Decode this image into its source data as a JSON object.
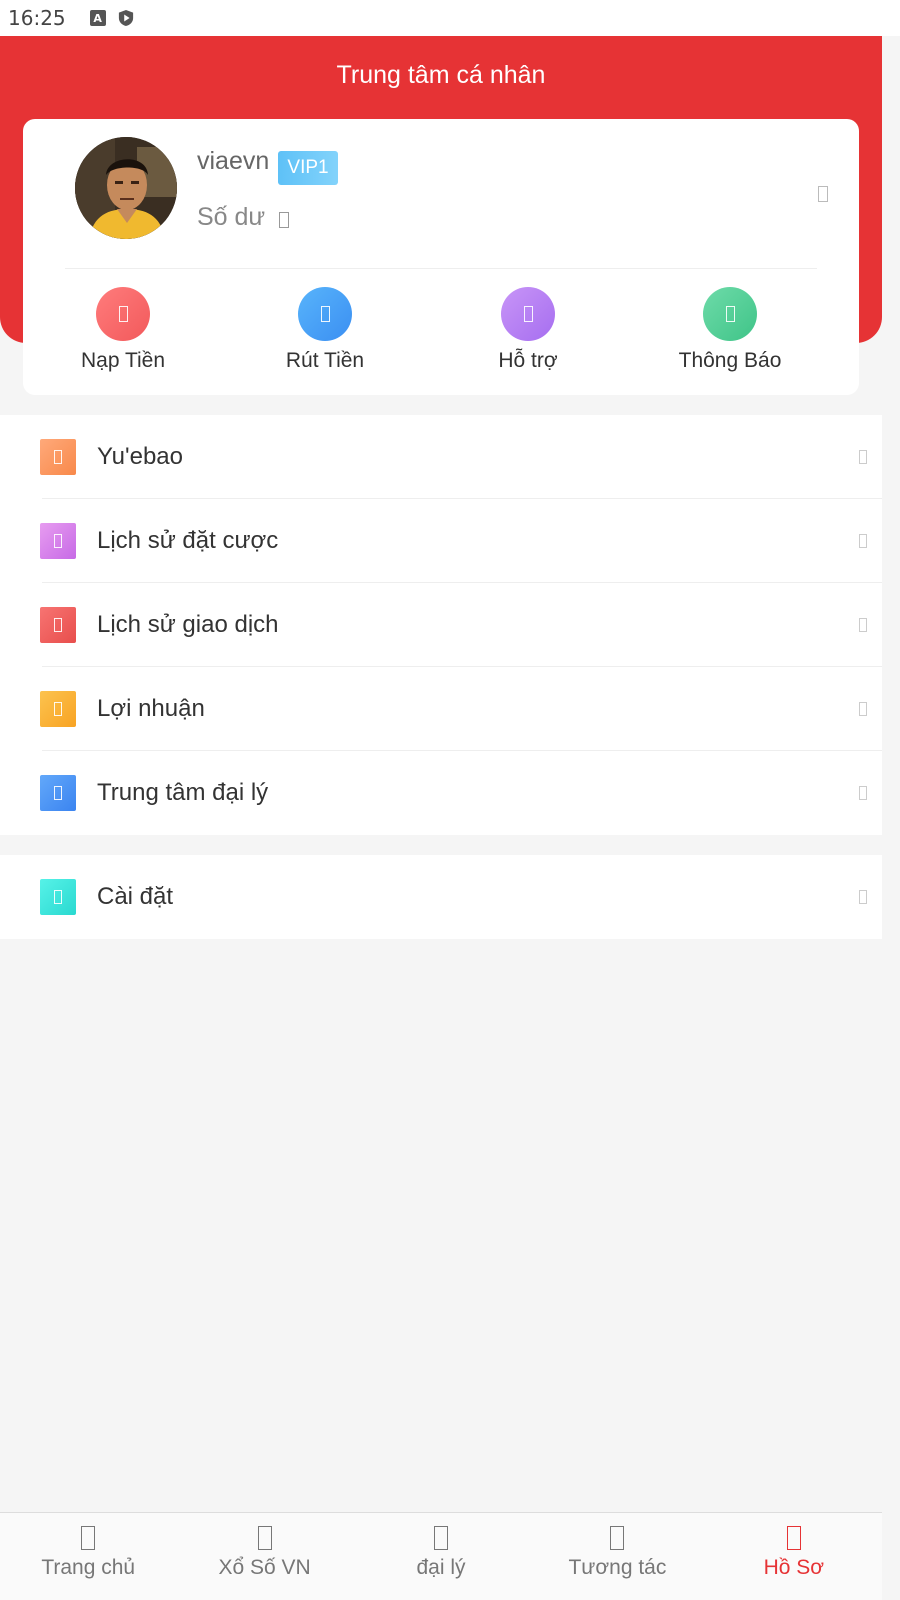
{
  "status_bar": {
    "time": "16:25",
    "icons": [
      "keyboard-a-icon",
      "shield-play-icon"
    ]
  },
  "header": {
    "title": "Trung tâm cá nhân",
    "background_color": "#e63335"
  },
  "profile": {
    "username": "viaevn",
    "vip_level": "VIP1",
    "balance_label": "Số dư"
  },
  "quick_actions": [
    {
      "label": "Nạp Tiền",
      "icon": "deposit-icon",
      "color": "#f46a6c"
    },
    {
      "label": "Rút Tiền",
      "icon": "withdraw-icon",
      "color": "#4aa0f5"
    },
    {
      "label": "Hỗ trợ",
      "icon": "support-icon",
      "color": "#b77ef2"
    },
    {
      "label": "Thông Báo",
      "icon": "notification-icon",
      "color": "#4fcf96"
    }
  ],
  "menu": [
    {
      "label": "Yu'ebao",
      "icon": "yuebao-icon",
      "color": "#fb9a62"
    },
    {
      "label": "Lịch sử đặt cược",
      "icon": "bet-history-icon",
      "color": "#d77cea"
    },
    {
      "label": "Lịch sử giao dịch",
      "icon": "transaction-history-icon",
      "color": "#f0615f"
    },
    {
      "label": "Lợi nhuận",
      "icon": "profit-icon",
      "color": "#fbb437"
    },
    {
      "label": "Trung tâm đại lý",
      "icon": "agent-center-icon",
      "color": "#4f98f7"
    }
  ],
  "settings": {
    "label": "Cài đặt",
    "icon": "settings-icon",
    "color": "#3de8de"
  },
  "tabbar": {
    "active_color": "#e63335",
    "tabs": [
      {
        "label": "Trang chủ",
        "icon": "home-icon"
      },
      {
        "label": "Xổ Số VN",
        "icon": "lottery-icon"
      },
      {
        "label": "đại lý",
        "icon": "agent-icon"
      },
      {
        "label": "Tương tác",
        "icon": "interact-icon"
      },
      {
        "label": "Hồ Sơ",
        "icon": "profile-icon",
        "active": true
      }
    ]
  }
}
